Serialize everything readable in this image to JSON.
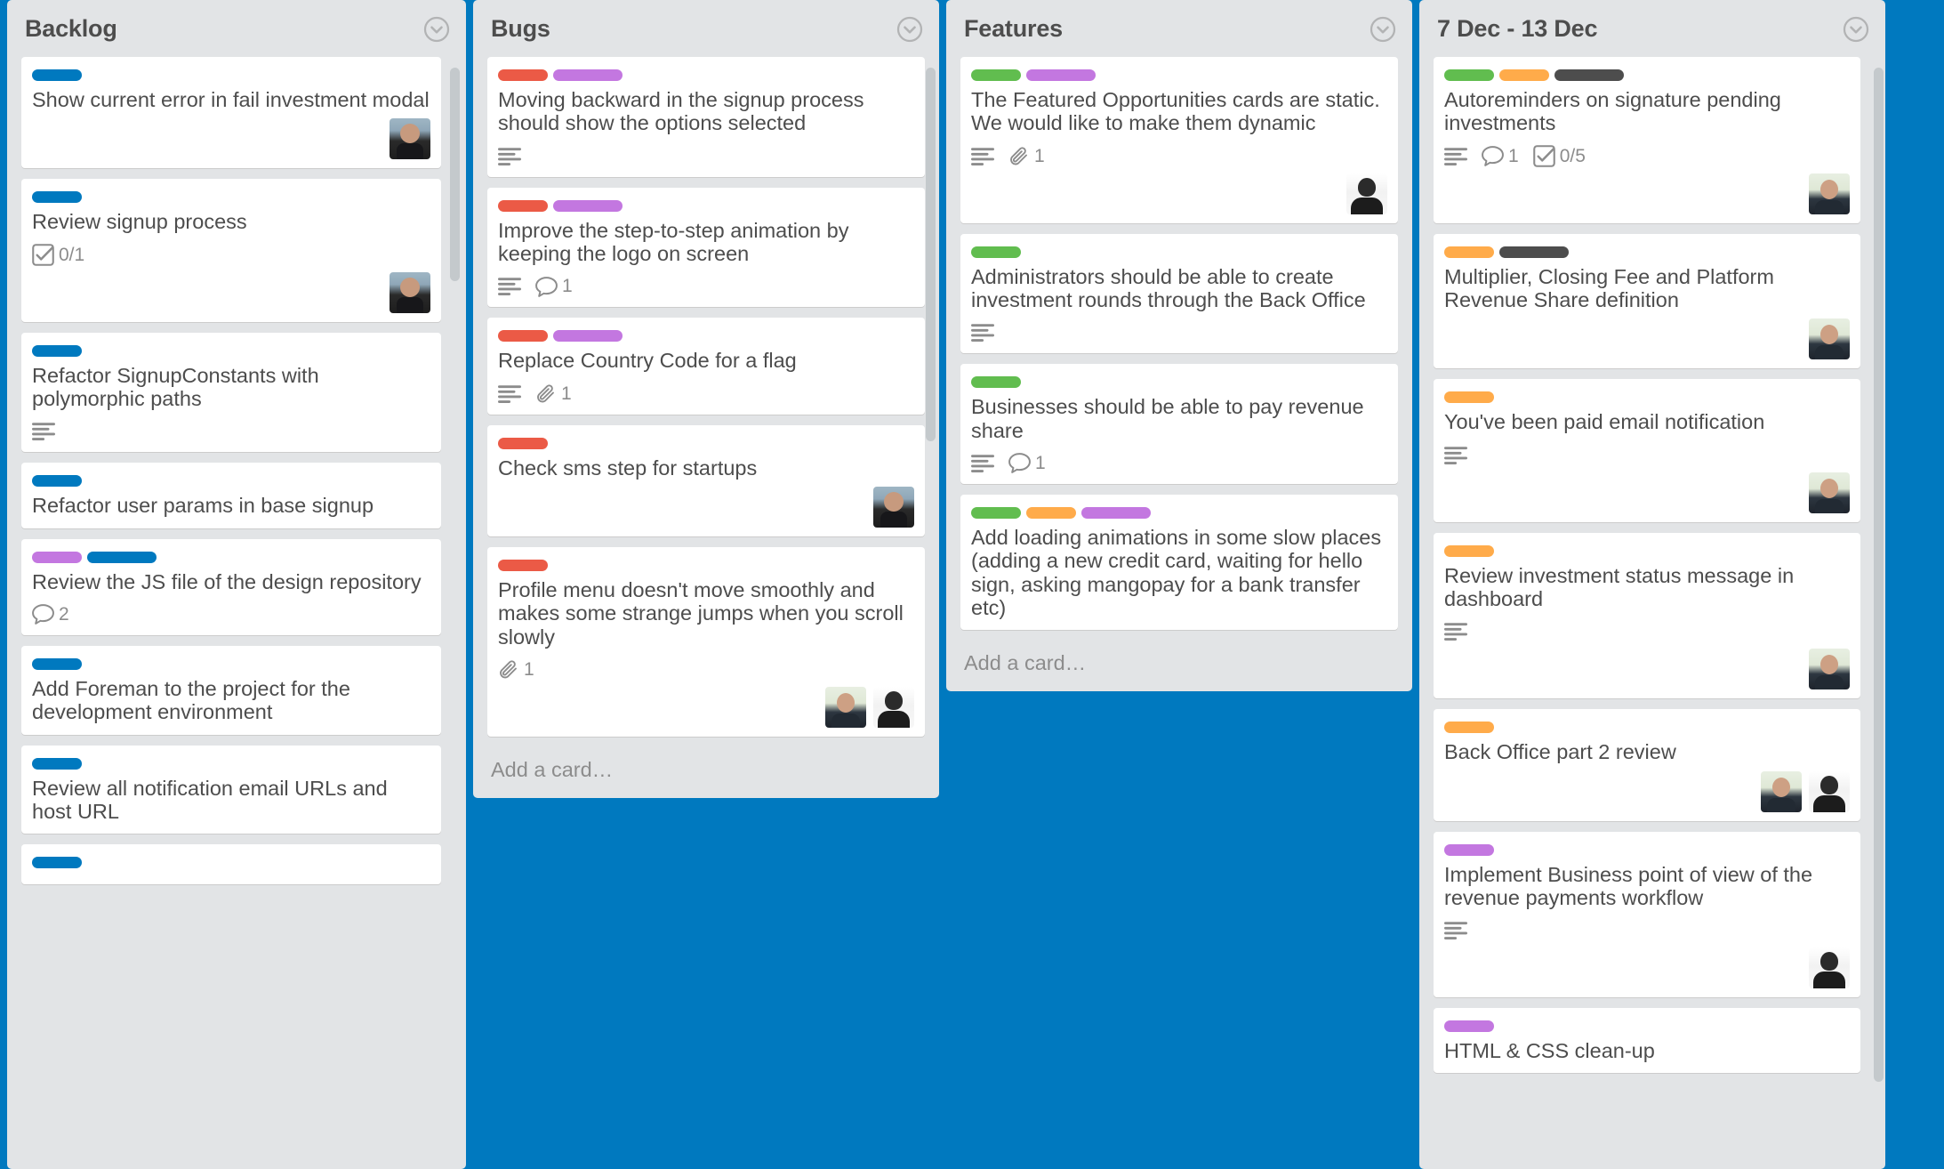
{
  "board": {
    "background_color": "#0079BF"
  },
  "label_colors": {
    "blue": "#0079BF",
    "purple": "#C377E0",
    "red": "#EB5A46",
    "green": "#61BD4F",
    "orange": "#FFAB4A",
    "black": "#4D4D4D"
  },
  "lists": [
    {
      "title": "Backlog",
      "add_card_label": "",
      "cards": [
        {
          "title": "Show current error in fail investment modal",
          "labels": [
            "blue"
          ],
          "members": [
            "p1"
          ],
          "badges": []
        },
        {
          "title": "Review signup process",
          "labels": [
            "blue"
          ],
          "members": [
            "p1"
          ],
          "badges": [
            {
              "type": "checklist",
              "text": "0/1"
            }
          ]
        },
        {
          "title": "Refactor SignupConstants with polymorphic paths",
          "labels": [
            "blue"
          ],
          "members": [],
          "badges": [
            {
              "type": "description",
              "text": ""
            }
          ]
        },
        {
          "title": "Refactor user params in base signup",
          "labels": [
            "blue"
          ],
          "members": [],
          "badges": []
        },
        {
          "title": "Review the JS file of the design repository",
          "labels": [
            "purple",
            "blue"
          ],
          "members": [],
          "badges": [
            {
              "type": "comment",
              "text": "2"
            }
          ]
        },
        {
          "title": "Add Foreman to the project for the development environment",
          "labels": [
            "blue"
          ],
          "members": [],
          "badges": []
        },
        {
          "title": "Review all notification email URLs and host URL",
          "labels": [
            "blue"
          ],
          "members": [],
          "badges": []
        },
        {
          "title": "",
          "labels": [
            "blue"
          ],
          "members": [],
          "badges": []
        }
      ]
    },
    {
      "title": "Bugs",
      "add_card_label": "Add a card…",
      "cards": [
        {
          "title": "Moving backward in the signup process should show the options selected",
          "labels": [
            "red",
            "purple"
          ],
          "members": [],
          "badges": [
            {
              "type": "description",
              "text": ""
            }
          ]
        },
        {
          "title": "Improve the step-to-step animation by keeping the logo on screen",
          "labels": [
            "red",
            "purple"
          ],
          "members": [],
          "badges": [
            {
              "type": "description",
              "text": ""
            },
            {
              "type": "comment",
              "text": "1"
            }
          ]
        },
        {
          "title": "Replace Country Code for a flag",
          "labels": [
            "red",
            "purple"
          ],
          "members": [],
          "badges": [
            {
              "type": "description",
              "text": ""
            },
            {
              "type": "attachment",
              "text": "1"
            }
          ]
        },
        {
          "title": "Check sms step for startups",
          "labels": [
            "red"
          ],
          "members": [
            "p1"
          ],
          "badges": []
        },
        {
          "title": "Profile menu doesn't move smoothly and makes some strange jumps when you scroll slowly",
          "labels": [
            "red"
          ],
          "members": [
            "p2",
            "p3"
          ],
          "badges": [
            {
              "type": "attachment",
              "text": "1"
            }
          ]
        }
      ]
    },
    {
      "title": "Features",
      "add_card_label": "Add a card…",
      "cards": [
        {
          "title": "The Featured Opportunities cards are static. We would like to make them dynamic",
          "labels": [
            "green",
            "purple"
          ],
          "members": [
            "p3"
          ],
          "badges": [
            {
              "type": "description",
              "text": ""
            },
            {
              "type": "attachment",
              "text": "1"
            }
          ]
        },
        {
          "title": "Administrators should be able to create investment rounds through the Back Office",
          "labels": [
            "green"
          ],
          "members": [],
          "badges": [
            {
              "type": "description",
              "text": ""
            }
          ]
        },
        {
          "title": "Businesses should be able to pay revenue share",
          "labels": [
            "green"
          ],
          "members": [],
          "badges": [
            {
              "type": "description",
              "text": ""
            },
            {
              "type": "comment",
              "text": "1"
            }
          ]
        },
        {
          "title": "Add loading animations in some slow places (adding a new credit card, waiting for hello sign, asking mangopay for a bank transfer etc)",
          "labels": [
            "green",
            "orange",
            "purple"
          ],
          "members": [],
          "badges": []
        }
      ]
    },
    {
      "title": "7 Dec - 13 Dec",
      "add_card_label": "",
      "cards": [
        {
          "title": "Autoreminders on signature pending investments",
          "labels": [
            "green",
            "orange",
            "black"
          ],
          "members": [
            "p2"
          ],
          "badges": [
            {
              "type": "description",
              "text": ""
            },
            {
              "type": "comment",
              "text": "1"
            },
            {
              "type": "checklist",
              "text": "0/5"
            }
          ]
        },
        {
          "title": "Multiplier, Closing Fee and Platform Revenue Share definition",
          "labels": [
            "orange",
            "black"
          ],
          "members": [
            "p2"
          ],
          "badges": []
        },
        {
          "title": "You've been paid email notification",
          "labels": [
            "orange"
          ],
          "members": [
            "p2"
          ],
          "badges": [
            {
              "type": "description",
              "text": ""
            }
          ]
        },
        {
          "title": "Review investment status message in dashboard",
          "labels": [
            "orange"
          ],
          "members": [
            "p2"
          ],
          "badges": [
            {
              "type": "description",
              "text": ""
            }
          ]
        },
        {
          "title": "Back Office part 2 review",
          "labels": [
            "orange"
          ],
          "members": [
            "p2",
            "p3"
          ],
          "badges": []
        },
        {
          "title": "Implement Business point of view of the revenue payments workflow",
          "labels": [
            "purple"
          ],
          "members": [
            "p3"
          ],
          "badges": [
            {
              "type": "description",
              "text": ""
            }
          ]
        },
        {
          "title": "HTML & CSS clean-up",
          "labels": [
            "purple"
          ],
          "members": [],
          "badges": []
        }
      ]
    }
  ]
}
